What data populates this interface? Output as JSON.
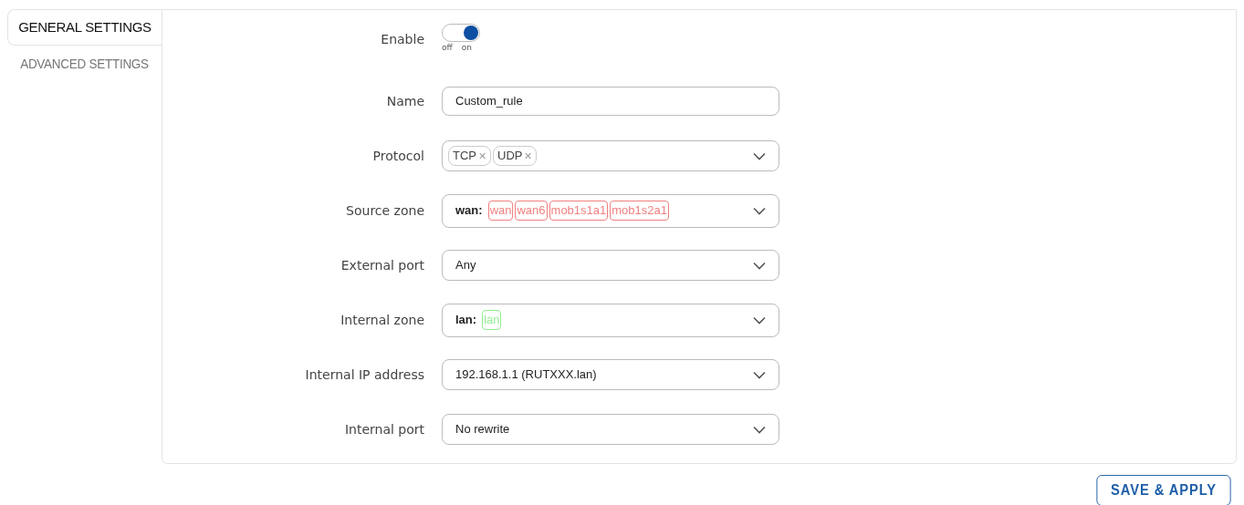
{
  "tabs": [
    {
      "label": "GENERAL SETTINGS",
      "selected": true
    },
    {
      "label": "ADVANCED SETTINGS",
      "selected": false
    }
  ],
  "fields": [
    {
      "kind": "toggle",
      "label": "Enable",
      "on": true,
      "off_text": "off",
      "on_text": "on"
    },
    {
      "kind": "text",
      "label": "Name",
      "value": "Custom_rule"
    },
    {
      "kind": "tags",
      "label": "Protocol",
      "tags": [
        "TCP",
        "UDP"
      ],
      "remove_icon": "✕"
    },
    {
      "kind": "zone",
      "label": "Source zone",
      "zone": "wan:",
      "color": "#f08080",
      "tags": [
        "wan",
        "wan6",
        "mob1s1a1",
        "mob1s2a1"
      ]
    },
    {
      "kind": "select",
      "label": "External port",
      "value": "Any"
    },
    {
      "kind": "zone",
      "label": "Internal zone",
      "zone": "lan:",
      "color": "#90ee90",
      "tags": [
        "lan"
      ]
    },
    {
      "kind": "select",
      "label": "Internal IP address",
      "value": "192.168.1.1 (RUTXXX.lan)"
    },
    {
      "kind": "select",
      "label": "Internal port",
      "value": "No rewrite"
    }
  ],
  "save_button": "SAVE & APPLY"
}
